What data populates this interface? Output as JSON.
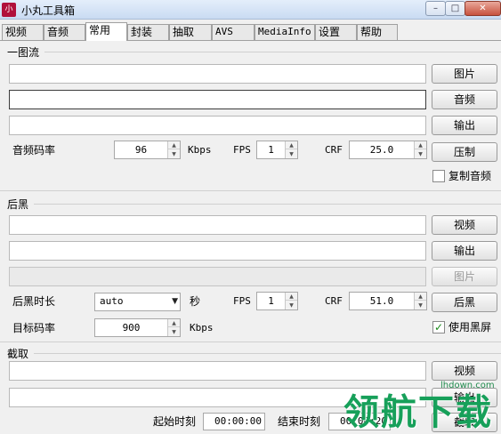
{
  "window": {
    "title": "小丸工具箱",
    "icon": "小",
    "min": "–",
    "max": "□",
    "close": "✕"
  },
  "tabs": [
    {
      "label": "视频",
      "active": false
    },
    {
      "label": "音频",
      "active": false
    },
    {
      "label": "常用",
      "active": true
    },
    {
      "label": "封装",
      "active": false
    },
    {
      "label": "抽取",
      "active": false
    },
    {
      "label": "AVS",
      "active": false
    },
    {
      "label": "MediaInfo",
      "active": false
    },
    {
      "label": "设置",
      "active": false
    },
    {
      "label": "帮助",
      "active": false
    }
  ],
  "section1": {
    "title": "一图流",
    "image_field": "",
    "audio_field": "",
    "output_field": "",
    "btn_image": "图片",
    "btn_audio": "音频",
    "btn_output": "输出",
    "btn_compress": "压制",
    "audio_bitrate_label": "音频码率",
    "audio_bitrate": "96",
    "kbps": "Kbps",
    "fps_label": "FPS",
    "fps": "1",
    "crf_label": "CRF",
    "crf": "25.0",
    "copy_audio_label": "复制音频",
    "copy_audio": false
  },
  "section2": {
    "title": "后黑",
    "video_field": "",
    "output_field": "",
    "image_field": "",
    "btn_video": "视频",
    "btn_output": "输出",
    "btn_image": "图片",
    "btn_black": "后黑",
    "duration_label": "后黑时长",
    "duration": "auto",
    "seconds": "秒",
    "fps_label": "FPS",
    "fps": "1",
    "crf_label": "CRF",
    "crf": "51.0",
    "target_bitrate_label": "目标码率",
    "target_bitrate": "900",
    "kbps": "Kbps",
    "use_black_label": "使用黑屏",
    "use_black": true
  },
  "section3": {
    "title": "截取",
    "video_field": "",
    "output_field": "",
    "btn_video": "视频",
    "btn_output": "输出",
    "btn_cut": "截取",
    "start_label": "起始时刻",
    "start_time": "00:00:00",
    "end_label": "结束时刻",
    "end_time": "00:00:20"
  },
  "watermark": {
    "url": "lhdown.com",
    "text": "领航下载"
  },
  "icons": {
    "spin_up": "▲",
    "spin_down": "▼",
    "combo_arrow": "▼",
    "check": "✓"
  }
}
